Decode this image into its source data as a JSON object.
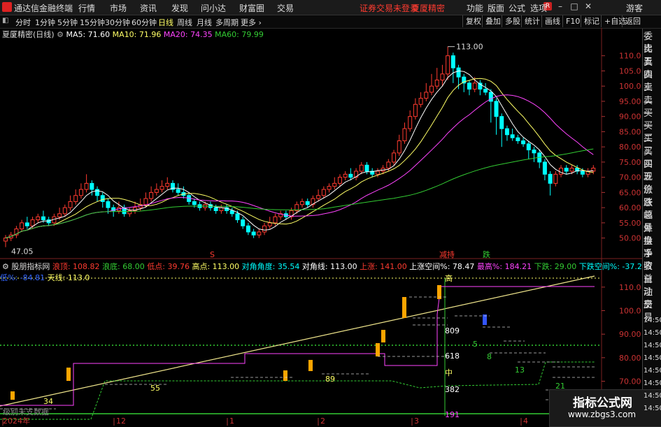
{
  "app": {
    "title": "通达信金融终端",
    "login_status": "证券交易未登录",
    "product": "夏厦精密",
    "guest": "游客"
  },
  "menu": [
    "行情",
    "市场",
    "资讯",
    "发现",
    "问小达",
    "财富圈",
    "交易"
  ],
  "right_menu": [
    "功能",
    "版面",
    "公式",
    "选项"
  ],
  "toolbar": {
    "periods": [
      "分时",
      "1分钟",
      "5分钟",
      "15分钟",
      "30分钟",
      "60分钟",
      "日线",
      "周线",
      "月线",
      "多周期",
      "更多"
    ],
    "selected": "日线",
    "right": [
      "复权",
      "叠加",
      "多股",
      "统计",
      "画线",
      "F10",
      "标记",
      "+自选",
      "返回"
    ]
  },
  "sidebar": [
    "委比",
    "卖五",
    "卖四",
    "卖三",
    "卖二",
    "卖一",
    "买一",
    "买二",
    "买三",
    "买四",
    "买五",
    "现价",
    "涨跌",
    "涨幅",
    "总量",
    "外盘",
    "换手",
    "净资",
    "收益",
    "自动",
    "注册",
    "交易",
    "14:50",
    "14:50",
    "14:50",
    "14:50",
    "14:50",
    "14:50",
    "14:50",
    "14:50"
  ],
  "ma": {
    "title": "夏厦精密(日线)",
    "ma5": "MA5: 71.60",
    "ma10": "MA10: 71.96",
    "ma20": "MA20: 74.35",
    "ma60": "MA60: 79.99"
  },
  "indicator": {
    "name": "股朋指标网",
    "items": [
      "浪顶: 108.82",
      "浪底: 68.00",
      "低点: 39.76",
      "高点: 113.00",
      "对角角度: 35.54",
      "对角线: 113.00",
      "上涨: 141.00",
      "上涨空间%: 78.47",
      "最高%: 184.21",
      "下跌: 29.00",
      "下跌空间%: -37.20",
      "最低%: -84.81",
      "天线: 113.0"
    ]
  },
  "colors": {
    "up": "#ff3b30",
    "down": "#00ffff",
    "ma5": "#ffffff",
    "ma10": "#ffff66",
    "ma20": "#ff44ff",
    "ma60": "#33cc33",
    "bar": "#ffa500"
  },
  "chart_data": [
    {
      "type": "candlestick",
      "y_ticks": [
        "110.0",
        "105.0",
        "100.0",
        "95.00",
        "90.00",
        "85.00",
        "80.00",
        "75.00",
        "70.00",
        "65.00",
        "60.00",
        "55.00",
        "50.00"
      ],
      "ylim": [
        46,
        115
      ],
      "high_label": "113.00",
      "low_label": "47.05",
      "signals": [
        "S",
        "减持",
        "跌"
      ],
      "candles": [
        [
          49,
          50,
          47,
          51
        ],
        [
          50,
          51,
          49,
          52
        ],
        [
          51,
          53,
          50,
          54
        ],
        [
          53,
          55,
          52,
          56
        ],
        [
          55,
          54,
          53,
          57
        ],
        [
          54,
          56,
          53,
          57
        ],
        [
          56,
          57,
          55,
          58
        ],
        [
          57,
          56,
          55,
          59
        ],
        [
          56,
          55,
          54,
          57
        ],
        [
          55,
          57,
          54,
          58
        ],
        [
          57,
          58,
          56,
          60
        ],
        [
          58,
          60,
          57,
          61
        ],
        [
          60,
          62,
          59,
          64
        ],
        [
          62,
          64,
          61,
          66
        ],
        [
          64,
          66,
          63,
          68
        ],
        [
          66,
          68,
          65,
          71
        ],
        [
          68,
          66,
          64,
          69
        ],
        [
          66,
          64,
          62,
          67
        ],
        [
          64,
          62,
          60,
          65
        ],
        [
          62,
          60,
          58,
          63
        ],
        [
          60,
          59,
          57,
          61
        ],
        [
          59,
          60,
          58,
          62
        ],
        [
          60,
          58,
          57,
          61
        ],
        [
          58,
          59,
          57,
          60
        ],
        [
          59,
          60,
          58,
          62
        ],
        [
          60,
          61,
          59,
          63
        ],
        [
          61,
          63,
          60,
          65
        ],
        [
          63,
          65,
          62,
          67
        ],
        [
          65,
          66,
          64,
          68
        ],
        [
          66,
          67,
          65,
          69
        ],
        [
          67,
          68,
          66,
          70
        ],
        [
          68,
          66,
          65,
          69
        ],
        [
          66,
          65,
          64,
          68
        ],
        [
          65,
          64,
          63,
          67
        ],
        [
          64,
          62,
          61,
          65
        ],
        [
          62,
          61,
          60,
          63
        ],
        [
          61,
          60,
          59,
          62
        ],
        [
          60,
          61,
          59,
          62
        ],
        [
          61,
          60,
          59,
          62
        ],
        [
          60,
          59,
          58,
          61
        ],
        [
          59,
          60,
          58,
          61
        ],
        [
          60,
          59,
          58,
          61
        ],
        [
          59,
          58,
          57,
          60
        ],
        [
          58,
          56,
          55,
          59
        ],
        [
          56,
          54,
          53,
          57
        ],
        [
          54,
          52,
          51,
          55
        ],
        [
          52,
          51,
          50,
          53
        ],
        [
          51,
          52,
          50,
          53
        ],
        [
          52,
          54,
          51,
          55
        ],
        [
          54,
          55,
          53,
          57
        ],
        [
          55,
          57,
          54,
          58
        ],
        [
          57,
          58,
          56,
          59
        ],
        [
          58,
          57,
          56,
          59
        ],
        [
          57,
          59,
          56,
          60
        ],
        [
          59,
          61,
          58,
          62
        ],
        [
          61,
          62,
          60,
          63
        ],
        [
          62,
          61,
          60,
          63
        ],
        [
          61,
          63,
          60,
          64
        ],
        [
          63,
          64,
          62,
          66
        ],
        [
          64,
          66,
          63,
          67
        ],
        [
          66,
          67,
          65,
          68
        ],
        [
          67,
          68,
          66,
          70
        ],
        [
          68,
          70,
          67,
          71
        ],
        [
          70,
          71,
          69,
          72
        ],
        [
          71,
          70,
          69,
          73
        ],
        [
          70,
          72,
          69,
          73
        ],
        [
          72,
          74,
          71,
          75
        ],
        [
          74,
          72,
          71,
          75
        ],
        [
          72,
          71,
          70,
          73
        ],
        [
          71,
          72,
          70,
          73
        ],
        [
          72,
          73,
          71,
          74
        ],
        [
          73,
          75,
          72,
          76
        ],
        [
          75,
          78,
          74,
          79
        ],
        [
          78,
          82,
          77,
          84
        ],
        [
          82,
          86,
          81,
          88
        ],
        [
          86,
          90,
          85,
          92
        ],
        [
          90,
          94,
          89,
          96
        ],
        [
          94,
          96,
          93,
          98
        ],
        [
          96,
          98,
          95,
          101
        ],
        [
          98,
          100,
          97,
          104
        ],
        [
          100,
          102,
          99,
          106
        ],
        [
          102,
          104,
          100,
          107
        ],
        [
          104,
          110,
          102,
          113
        ],
        [
          110,
          106,
          101,
          111
        ],
        [
          106,
          103,
          99,
          107
        ],
        [
          103,
          101,
          98,
          104
        ],
        [
          101,
          99,
          97,
          102
        ],
        [
          99,
          101,
          98,
          103
        ],
        [
          101,
          99,
          97,
          102
        ],
        [
          99,
          98,
          97,
          101
        ],
        [
          98,
          95,
          88,
          99
        ],
        [
          95,
          90,
          84,
          96
        ],
        [
          90,
          86,
          80,
          91
        ],
        [
          86,
          84,
          82,
          87
        ],
        [
          84,
          83,
          82,
          86
        ],
        [
          83,
          82,
          81,
          84
        ],
        [
          82,
          81,
          80,
          83
        ],
        [
          81,
          79,
          76,
          82
        ],
        [
          79,
          78,
          75,
          80
        ],
        [
          78,
          75,
          73,
          79
        ],
        [
          75,
          71,
          69,
          76
        ],
        [
          71,
          68,
          64,
          72
        ],
        [
          68,
          71,
          67,
          72
        ],
        [
          71,
          73,
          70,
          74
        ],
        [
          73,
          72,
          71,
          74
        ],
        [
          72,
          73,
          71,
          74
        ],
        [
          73,
          72,
          71,
          74
        ],
        [
          72,
          71,
          70,
          73
        ],
        [
          71,
          72,
          70,
          73
        ],
        [
          72,
          73,
          71,
          74
        ]
      ]
    },
    {
      "type": "indicator",
      "y_ticks": [
        "110.0",
        "100.0",
        "90.00",
        "80.00",
        "70.00",
        "60.00"
      ],
      "ylim": [
        55,
        115
      ],
      "levels": [
        "高",
        "809",
        "618",
        "中",
        "382",
        "191",
        "最低"
      ],
      "labels": [
        "34",
        "55",
        "89",
        "5",
        "8",
        "13",
        "21"
      ],
      "x_labels": [
        "2024年",
        "12",
        "1",
        "2",
        "3",
        "4"
      ],
      "note": "级别未支数据"
    }
  ]
}
